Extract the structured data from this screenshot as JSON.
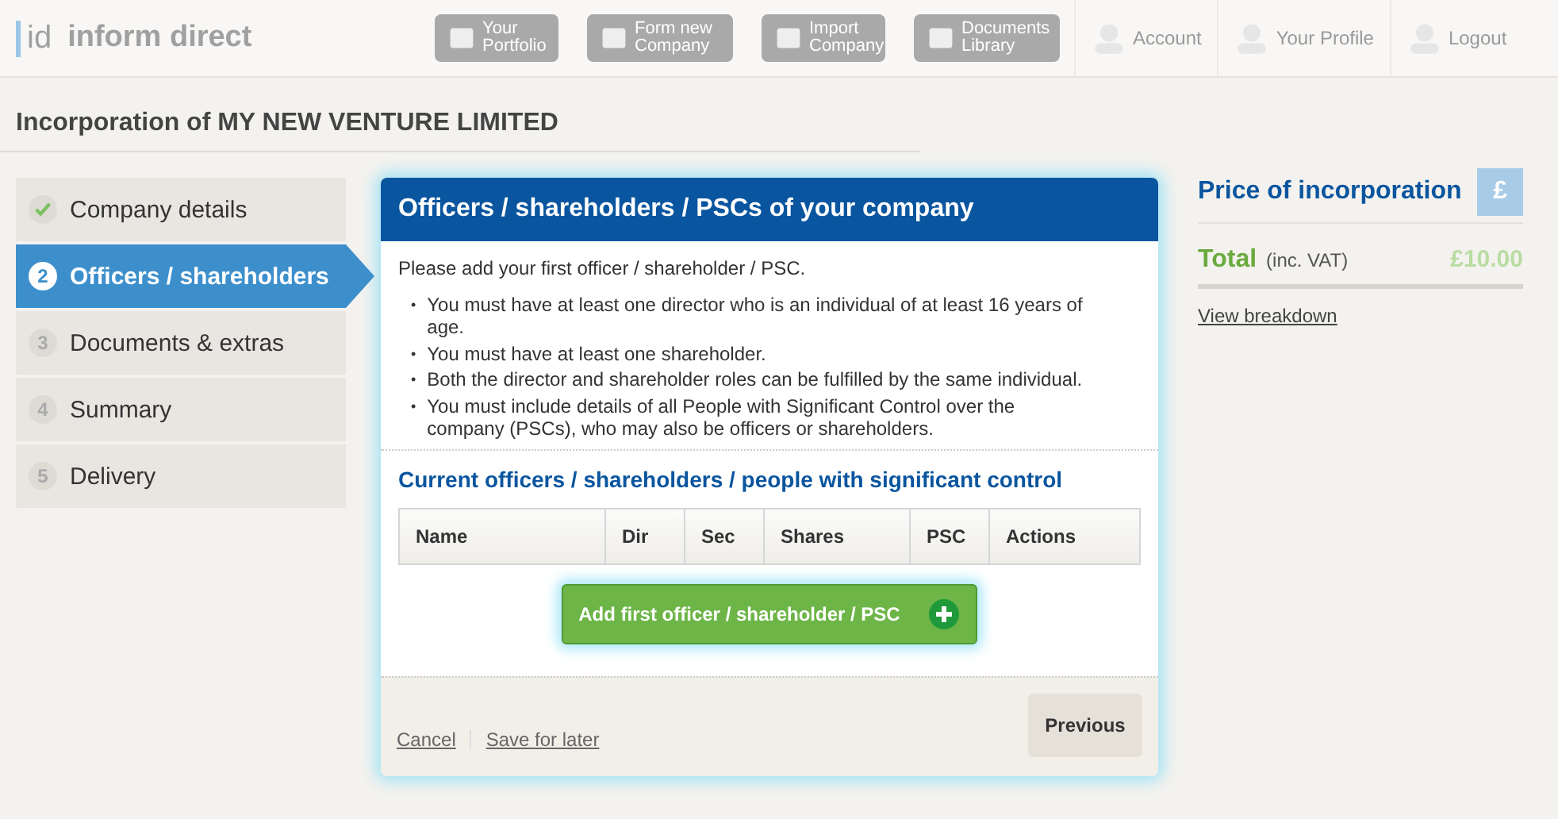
{
  "logo": {
    "mark": "id",
    "name": "inform direct"
  },
  "nav": [
    {
      "label": "Your Portfolio",
      "kind": "tile"
    },
    {
      "label": "Form new Company",
      "kind": "tile"
    },
    {
      "label": "Import Company",
      "kind": "tile"
    },
    {
      "label": "Documents Library",
      "kind": "tile"
    },
    {
      "label": "Account",
      "kind": "link"
    },
    {
      "label": "Your Profile",
      "kind": "link"
    },
    {
      "label": "Logout",
      "kind": "link"
    }
  ],
  "page_title": "Incorporation of MY NEW VENTURE LIMITED",
  "steps": [
    {
      "kind": "check",
      "label": "Company details",
      "selected": false
    },
    {
      "kind": "number",
      "number": "2",
      "label": "Officers / shareholders",
      "selected": true
    },
    {
      "kind": "number",
      "number": "3",
      "label": "Documents & extras",
      "selected": false
    },
    {
      "kind": "number",
      "number": "4",
      "label": "Summary",
      "selected": false
    },
    {
      "kind": "number",
      "number": "5",
      "label": "Delivery",
      "selected": false
    }
  ],
  "panel": {
    "bullet": "•",
    "title": "Officers / shareholders / PSCs of your company",
    "intro": "Please add your first officer / shareholder / PSC.",
    "rules": [
      "You must have at least one director who is an individual of at least 16 years of age.",
      "You must have at least one shareholder.",
      "Both the director and shareholder roles can be fulfilled by the same individual.",
      "You must include details of all People with Significant Control over the company (PSCs), who may also be officers or shareholders."
    ],
    "section_title": "Current officers / shareholders / people with significant control",
    "table": {
      "columns": [
        "Name",
        "Dir",
        "Sec",
        "Shares",
        "PSC",
        "Actions"
      ]
    },
    "add_button": "Add first officer / shareholder / PSC",
    "cancel": "Cancel",
    "save": "Save for later",
    "previous": "Previous"
  },
  "price": {
    "title": "Price of incorporation",
    "symbol": "£",
    "total_label": "Total",
    "total_note": "(inc. VAT)",
    "total_value": "£10.00",
    "breakdown": "View breakdown"
  }
}
